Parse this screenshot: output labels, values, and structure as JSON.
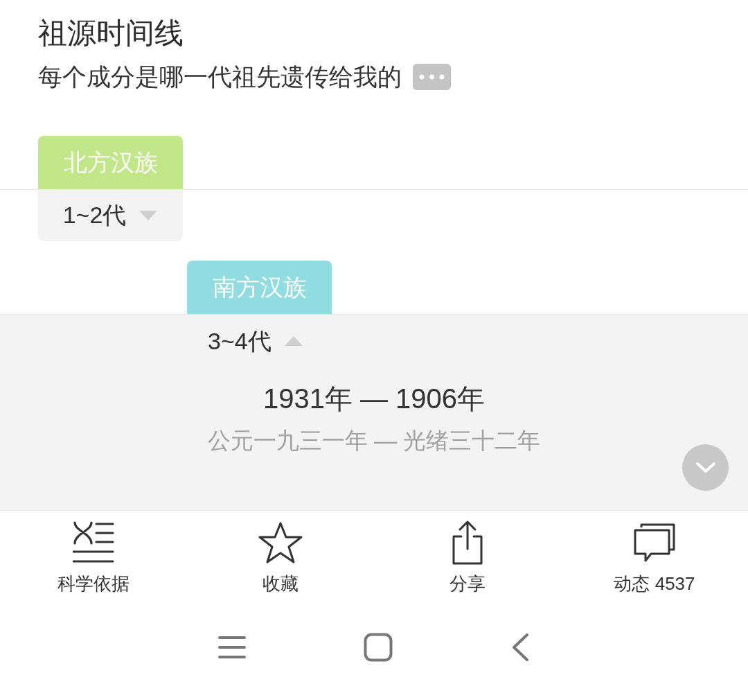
{
  "header": {
    "title": "祖源时间线",
    "subtitle": "每个成分是哪一代祖先遗传给我的"
  },
  "timeline": [
    {
      "label": "北方汉族",
      "color": "#c2e788",
      "generations": "1~2代",
      "expanded": false
    },
    {
      "label": "南方汉族",
      "color": "#8fdde0",
      "generations": "3~4代",
      "expanded": true,
      "years": "1931年 — 1906年",
      "era": "公元一九三一年 — 光绪三十二年"
    }
  ],
  "actions": [
    {
      "kind": "evidence",
      "label": "科学依据"
    },
    {
      "kind": "star",
      "label": "收藏"
    },
    {
      "kind": "share",
      "label": "分享"
    },
    {
      "kind": "comments",
      "label": "动态 4537"
    }
  ]
}
